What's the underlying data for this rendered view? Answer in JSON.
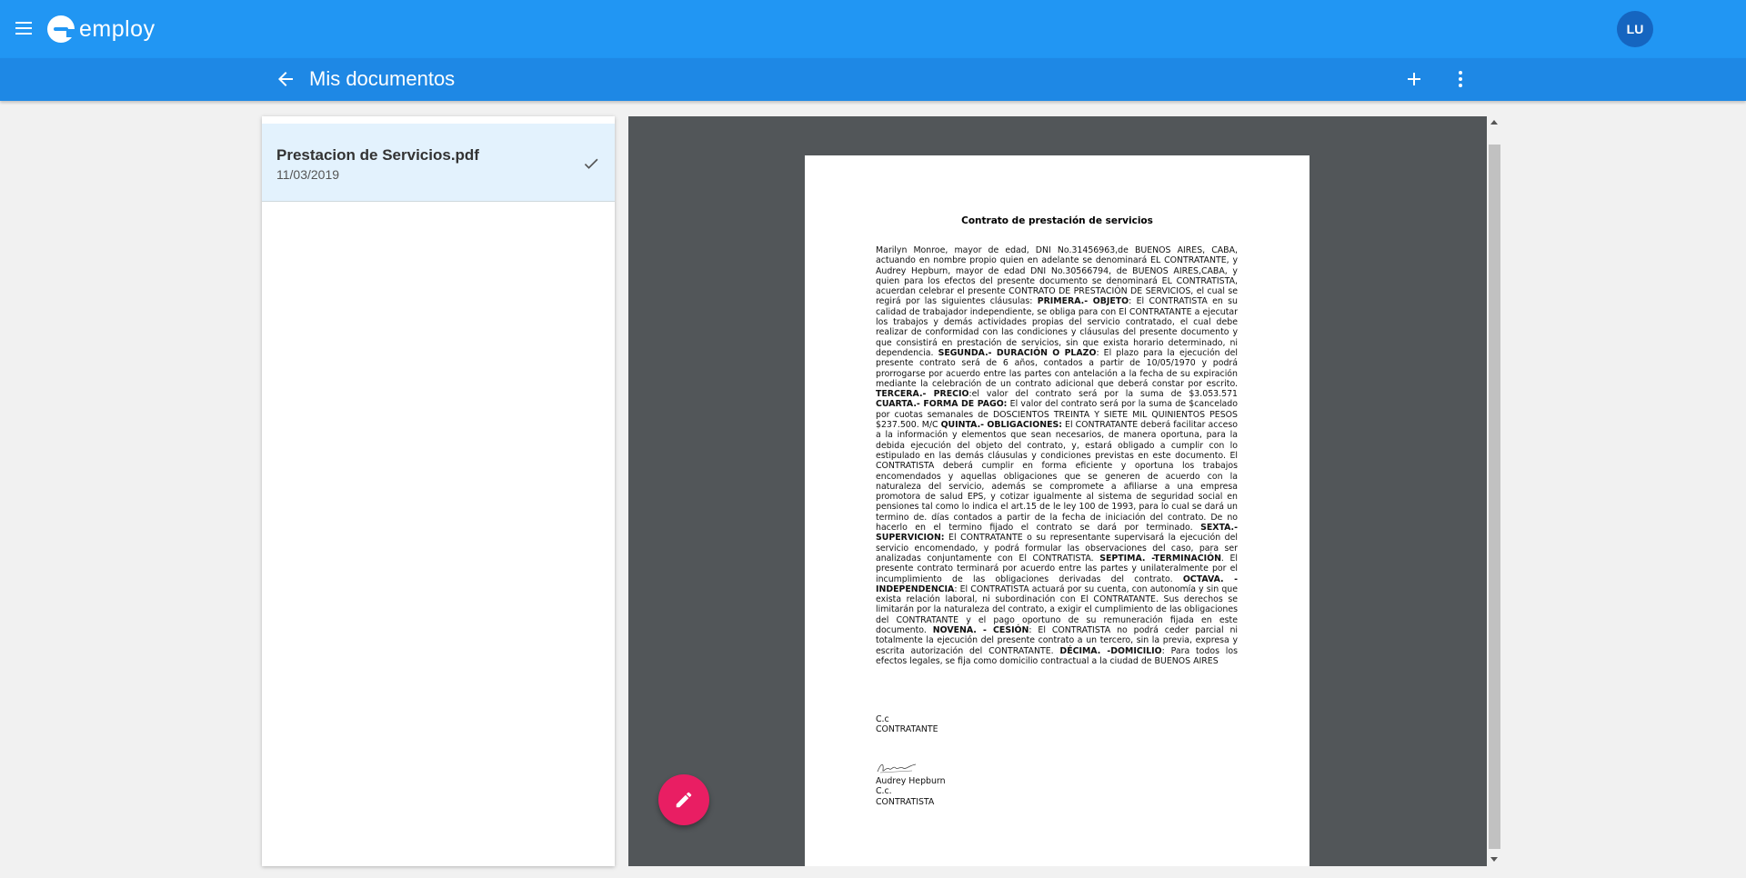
{
  "app": {
    "logo_text": "employ",
    "avatar_initials": "LU"
  },
  "header": {
    "title": "Mis documentos"
  },
  "documents": [
    {
      "name": "Prestacion de Servicios.pdf",
      "date": "11/03/2019",
      "selected": true
    }
  ],
  "pdf": {
    "title": "Contrato de prestación de servicios",
    "paragraph": [
      {
        "t": "Marilyn Monroe, mayor de edad, DNI No.31456963,de BUENOS AIRES, CABA, actuando en nombre propio quien en adelante se denominará EL CONTRATANTE, y Audrey Hepburn, mayor de edad DNI No.30566794, de BUENOS AIRES,CABA, y quien para los efectos del presente documento se denominará EL CONTRATISTA, acuerdan celebrar el presente CONTRATO DE PRESTACIÓN DE SERVICIOS, el cual se regirá por las siguientes cláusulas: "
      },
      {
        "t": "PRIMERA.- OBJETO",
        "b": true
      },
      {
        "t": ": El CONTRATISTA en su calidad de trabajador independiente, se obliga para con El CONTRATANTE a ejecutar los trabajos y demás actividades propias del servicio contratado, el cual debe realizar de conformidad con las condiciones y cláusulas del presente documento y que consistirá en prestación de servicios, sin que exista horario determinado, ni dependencia. "
      },
      {
        "t": "SEGUNDA.- DURACIÓN O PLAZO",
        "b": true
      },
      {
        "t": ": El plazo para la ejecución del presente contrato será de 6 años, contados a partir de 10/05/1970 y podrá prorrogarse por acuerdo entre las partes con antelación a la fecha de su expiración mediante la celebración de un contrato adicional que deberá constar por escrito. "
      },
      {
        "t": "TERCERA.- PRECIO",
        "b": true
      },
      {
        "t": ":el valor del contrato será por la suma de $3.053.571 "
      },
      {
        "t": "CUARTA.- FORMA DE PAGO:",
        "b": true
      },
      {
        "t": " El valor del contrato será por la suma de $cancelado por cuotas semanales de DOSCIENTOS TREINTA Y SIETE MIL QUINIENTOS PESOS $237.500. M/C "
      },
      {
        "t": "QUINTA.- OBLIGACIONES:",
        "b": true
      },
      {
        "t": " El CONTRATANTE deberá facilitar acceso a la información y elementos que sean necesarios, de manera oportuna, para la debida ejecución del objeto del contrato, y, estará obligado a cumplir con lo estipulado en las demás cláusulas y condiciones previstas en este documento. El CONTRATISTA deberá cumplir en forma eficiente y oportuna los trabajos encomendados y aquellas obligaciones que se generen de acuerdo con la naturaleza del servicio, además se compromete a afiliarse a una empresa promotora de salud EPS, y cotizar igualmente al sistema de seguridad social en pensiones tal como lo indica el art.15 de le ley 100 de 1993, para lo cual se dará un termino de. días contados a partir de la fecha de iniciación del contrato. De no hacerlo en el termino fijado el contrato se dará por terminado. "
      },
      {
        "t": "SEXTA.- SUPERVICION:",
        "b": true
      },
      {
        "t": " El CONTRATANTE o su representante supervisará la ejecución del servicio encomendado, y podrá formular las observaciones del caso, para ser analizadas conjuntamente con El CONTRATISTA. "
      },
      {
        "t": "SEPTIMA. -TERMINACIÓN",
        "b": true
      },
      {
        "t": ". El presente contrato terminará por acuerdo entre las partes y unilateralmente por el incumplimiento de las obligaciones derivadas del contrato. "
      },
      {
        "t": "OCTAVA. - INDEPENDENCIA",
        "b": true
      },
      {
        "t": ": El CONTRATISTA actuará por su cuenta, con autonomía y sin que exista relación laboral, ni subordinación con El CONTRATANTE. Sus derechos se limitarán por la naturaleza del contrato, a exigir el cumplimiento de las obligaciones del CONTRATANTE y el pago oportuno de su remuneración fijada en este documento. "
      },
      {
        "t": "NOVENA. - CESIÓN",
        "b": true
      },
      {
        "t": ": El CONTRATISTA no podrá ceder parcial ni totalmente la ejecución del presente contrato a un tercero, sin la previa, expresa y escrita autorización del CONTRATANTE. "
      },
      {
        "t": "DÉCIMA. -DOMICILIO",
        "b": true
      },
      {
        "t": ": Para todos los efectos legales, se fija como domicilio contractual a la ciudad de BUENOS AIRES"
      }
    ],
    "contratante_cc": "C.c",
    "contratante_label": "CONTRATANTE",
    "contratista_name": "Audrey Hepburn",
    "contratista_cc": "C.c.",
    "contratista_label": "CONTRATISTA"
  },
  "icons": {
    "menu": "menu-icon",
    "back": "arrow-back-icon",
    "add": "plus-icon",
    "more": "more-vert-icon",
    "check": "check-icon",
    "edit": "pencil-icon"
  },
  "colors": {
    "primary": "#2196f3",
    "primary_dark": "#1e88e5",
    "avatar": "#1565c0",
    "accent": "#e91e63",
    "selected_row": "#e3f2fd",
    "viewer_bg": "#525659"
  }
}
